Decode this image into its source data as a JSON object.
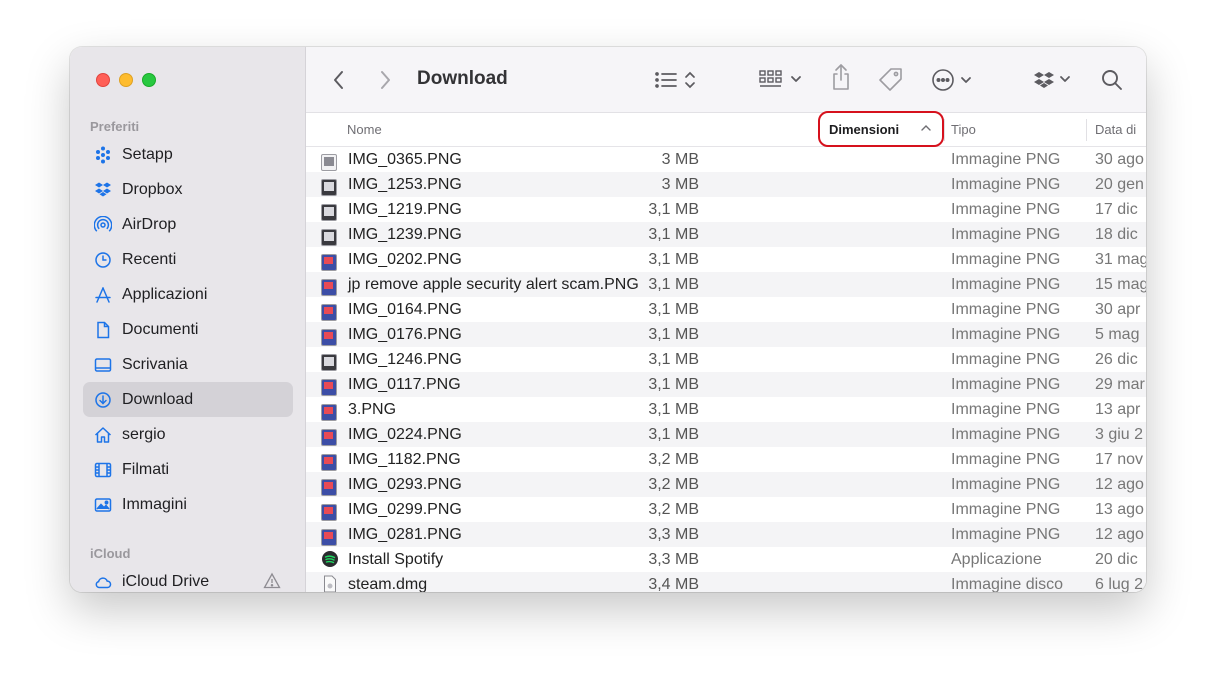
{
  "window": {
    "title": "Download"
  },
  "sidebar": {
    "favorites_label": "Preferiti",
    "favorites": [
      {
        "label": "Setapp",
        "icon": "setapp-icon"
      },
      {
        "label": "Dropbox",
        "icon": "dropbox-icon"
      },
      {
        "label": "AirDrop",
        "icon": "airdrop-icon"
      },
      {
        "label": "Recenti",
        "icon": "clock-icon"
      },
      {
        "label": "Applicazioni",
        "icon": "applications-icon"
      },
      {
        "label": "Documenti",
        "icon": "document-icon"
      },
      {
        "label": "Scrivania",
        "icon": "desktop-icon"
      },
      {
        "label": "Download",
        "icon": "download-icon",
        "active": true
      },
      {
        "label": "sergio",
        "icon": "home-icon"
      },
      {
        "label": "Filmati",
        "icon": "film-icon"
      },
      {
        "label": "Immagini",
        "icon": "photo-icon"
      }
    ],
    "icloud_label": "iCloud",
    "icloud": [
      {
        "label": "iCloud Drive",
        "icon": "cloud-icon",
        "warning_icon": "warning-icon"
      }
    ]
  },
  "columns": {
    "name": "Nome",
    "size": "Dimensioni",
    "type": "Tipo",
    "date": "Data di"
  },
  "files": [
    {
      "name": "IMG_0365.PNG",
      "size": "3 MB",
      "type": "Immagine PNG",
      "date": "30 ago",
      "icon": "light"
    },
    {
      "name": "IMG_1253.PNG",
      "size": "3 MB",
      "type": "Immagine PNG",
      "date": "20 gen",
      "icon": "dark"
    },
    {
      "name": "IMG_1219.PNG",
      "size": "3,1 MB",
      "type": "Immagine PNG",
      "date": "17 dic",
      "icon": "dark"
    },
    {
      "name": "IMG_1239.PNG",
      "size": "3,1 MB",
      "type": "Immagine PNG",
      "date": "18 dic",
      "icon": "dark"
    },
    {
      "name": "IMG_0202.PNG",
      "size": "3,1 MB",
      "type": "Immagine PNG",
      "date": "31 mag",
      "icon": "red"
    },
    {
      "name": "jp remove apple security alert scam.PNG",
      "size": "3,1 MB",
      "type": "Immagine PNG",
      "date": "15 mag",
      "icon": "red"
    },
    {
      "name": "IMG_0164.PNG",
      "size": "3,1 MB",
      "type": "Immagine PNG",
      "date": "30 apr",
      "icon": "red"
    },
    {
      "name": "IMG_0176.PNG",
      "size": "3,1 MB",
      "type": "Immagine PNG",
      "date": "5 mag",
      "icon": "red"
    },
    {
      "name": "IMG_1246.PNG",
      "size": "3,1 MB",
      "type": "Immagine PNG",
      "date": "26 dic",
      "icon": "dark"
    },
    {
      "name": "IMG_0117.PNG",
      "size": "3,1 MB",
      "type": "Immagine PNG",
      "date": "29 mar",
      "icon": "red"
    },
    {
      "name": "3.PNG",
      "size": "3,1 MB",
      "type": "Immagine PNG",
      "date": "13 apr",
      "icon": "red"
    },
    {
      "name": "IMG_0224.PNG",
      "size": "3,1 MB",
      "type": "Immagine PNG",
      "date": "3 giu 2",
      "icon": "red"
    },
    {
      "name": "IMG_1182.PNG",
      "size": "3,2 MB",
      "type": "Immagine PNG",
      "date": "17 nov",
      "icon": "red"
    },
    {
      "name": "IMG_0293.PNG",
      "size": "3,2 MB",
      "type": "Immagine PNG",
      "date": "12 ago",
      "icon": "red"
    },
    {
      "name": "IMG_0299.PNG",
      "size": "3,2 MB",
      "type": "Immagine PNG",
      "date": "13 ago",
      "icon": "red"
    },
    {
      "name": "IMG_0281.PNG",
      "size": "3,3 MB",
      "type": "Immagine PNG",
      "date": "12 ago",
      "icon": "red"
    },
    {
      "name": "Install Spotify",
      "size": "3,3 MB",
      "type": "Applicazione",
      "date": "20 dic",
      "icon": "app"
    },
    {
      "name": "steam.dmg",
      "size": "3,4 MB",
      "type": "Immagine disco",
      "date": "6 lug 2",
      "icon": "disk"
    }
  ],
  "colors": {
    "accent": "#1d74e8",
    "highlight": "#d6111d"
  }
}
